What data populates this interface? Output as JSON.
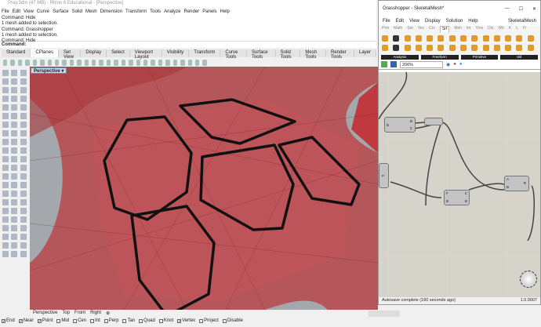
{
  "window_title": "Pray.3dm (47 MB) - Rhino 6 Educational - [Perspective]",
  "menu": [
    "File",
    "Edit",
    "View",
    "Curve",
    "Surface",
    "Solid",
    "Mesh",
    "Dimension",
    "Transform",
    "Tools",
    "Analyze",
    "Render",
    "Panels",
    "Help"
  ],
  "history": [
    "Command: Hide",
    "1 mesh added to selection.",
    "Command: Grasshopper",
    "1 mesh added to selection.",
    "Command: Hide"
  ],
  "command_prompt": "Command:",
  "tabs": [
    "Standard",
    "CPlanes",
    "Set View",
    "Display",
    "Select",
    "Viewport Layout",
    "Visibility",
    "Transform",
    "Curve Tools",
    "Surface Tools",
    "Solid Tools",
    "Mesh Tools",
    "Render Tools",
    "Layer"
  ],
  "active_tab": "CPlanes",
  "viewport": {
    "label": "Perspective ▾"
  },
  "viewport_tabs": [
    "Perspective",
    "Top",
    "Front",
    "Right",
    "⊕"
  ],
  "osnaps": [
    {
      "label": "End",
      "checked": true
    },
    {
      "label": "Near",
      "checked": true
    },
    {
      "label": "Point",
      "checked": true
    },
    {
      "label": "Mid",
      "checked": false
    },
    {
      "label": "Cen",
      "checked": false
    },
    {
      "label": "Int",
      "checked": false
    },
    {
      "label": "Perp",
      "checked": false
    },
    {
      "label": "Tan",
      "checked": false
    },
    {
      "label": "Quad",
      "checked": false
    },
    {
      "label": "Knot",
      "checked": false
    },
    {
      "label": "Vertex",
      "checked": true
    },
    {
      "label": "Project",
      "checked": false
    },
    {
      "label": "Disable",
      "checked": false
    }
  ],
  "grasshopper": {
    "title": "Grasshopper - SkeletalMesh*",
    "window_controls": [
      "—",
      "☐",
      "✕"
    ],
    "menu": [
      "File",
      "Edit",
      "View",
      "Display",
      "Solution",
      "Help"
    ],
    "doc_name": "SkeletalMesh",
    "tabs": [
      "Prm",
      "Math",
      "Set",
      "Vec",
      "Crv",
      "Srf",
      "Msh",
      "Int",
      "Trns",
      "Dis",
      "Wb",
      "K",
      "L",
      "H"
    ],
    "active_tab": "Srf",
    "groups": [
      "Analysis",
      "Freeform",
      "Primitive",
      "Util"
    ],
    "zoom": "206%",
    "status": "Autosave complete (160 seconds ago)",
    "version": "1.0.0007",
    "nodes": {
      "n1": [
        "B",
        "B",
        "C"
      ],
      "n2": [
        "P"
      ],
      "n3": [
        "F",
        "B",
        "C",
        "B"
      ],
      "n4": [
        "A",
        "B",
        "R"
      ]
    }
  }
}
